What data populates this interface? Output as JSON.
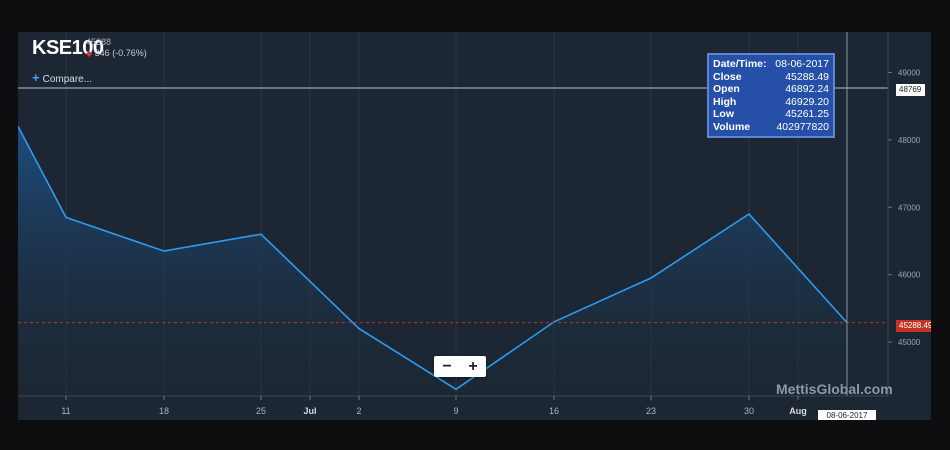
{
  "header": {
    "symbol": "KSE100",
    "last_value": "45288",
    "change": "346 (-0.76%)",
    "compare_label": "Compare..."
  },
  "tooltip": {
    "rows": [
      {
        "label": "Date/Time:",
        "value": "08-06-2017"
      },
      {
        "label": "Close",
        "value": "45288.49"
      },
      {
        "label": "Open",
        "value": "46892.24"
      },
      {
        "label": "High",
        "value": "46929.20"
      },
      {
        "label": "Low",
        "value": "45261.25"
      },
      {
        "label": "Volume",
        "value": "402977820"
      }
    ]
  },
  "crosshair": {
    "price_label": "48769",
    "date_label": "08-06-2017"
  },
  "last_price_label": "45288.49",
  "zoom": {
    "minus": "−",
    "plus": "+"
  },
  "watermark": "MettisGlobal.com",
  "colors": {
    "background": "#1c2733",
    "line": "#2b9cf2",
    "area_top": "#1d4f82",
    "last_price": "#c43321"
  },
  "chart_data": {
    "type": "area",
    "title": "KSE100",
    "x_ticks": [
      "11",
      "18",
      "25",
      "Jul",
      "2",
      "9",
      "16",
      "23",
      "30",
      "Aug"
    ],
    "y_ticks": [
      45000,
      46000,
      47000,
      48000,
      49000
    ],
    "ylim": [
      44200,
      49600
    ],
    "series": [
      {
        "x": [
          "06-04",
          "06-11",
          "06-18",
          "06-25",
          "07-02",
          "07-09",
          "07-16",
          "07-23",
          "07-30",
          "08-06"
        ],
        "values": [
          48200,
          46850,
          46350,
          46600,
          45200,
          44300,
          45300,
          45950,
          46900,
          45288.49
        ]
      }
    ],
    "last_price": 45288.49,
    "crosshair_price": 48769,
    "grid": "vertical"
  }
}
